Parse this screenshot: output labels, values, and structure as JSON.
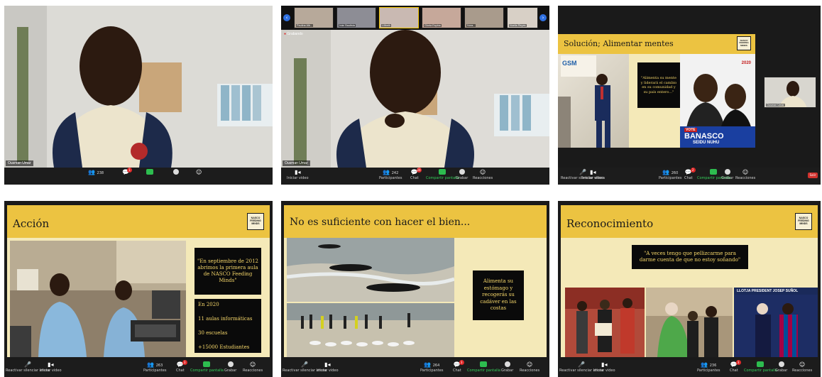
{
  "panels": {
    "p1": {
      "speaker_name": "Ousman Umar",
      "participants_count": "238",
      "chat_badge": "1"
    },
    "p2": {
      "gallery": [
        {
          "name": "Paulina Alb..."
        },
        {
          "name": "Iván Bautista"
        },
        {
          "name": "Lilibeth"
        },
        {
          "name": "Gloria Espina"
        },
        {
          "name": "Nora..."
        },
        {
          "name": "Noelia Reyes"
        }
      ],
      "recording_label": "Grabando",
      "speaker_name": "Ousman Umar",
      "participants_count": "242",
      "chat_badge": "24",
      "controls": {
        "start_video": "Iniciar video",
        "participants": "Participantes",
        "chat": "Chat",
        "share": "Compartir pantalla",
        "record": "Grabar",
        "reactions": "Reacciones"
      }
    },
    "p3": {
      "slide_title": "Solución; Alimentar mentes",
      "logo_text": "NASCO\nFEEDING\nMINDS",
      "quote": "\"Alimenta su mente y liderará el cambio en su comunidad y su país entero...\"",
      "poster_year": "2020",
      "poster_vote": "VOTE",
      "poster_name1": "BANASCO",
      "poster_name2": "SEIDU NUHU",
      "side_thumb_name": "Ousman Umar",
      "participants_count": "260",
      "chat_badge": "2",
      "controls": {
        "unmute": "Reactivar silenciar ahora",
        "start_video": "Iniciar video",
        "participants": "Participantes",
        "chat": "Chat",
        "share": "Compartir pantalla",
        "record": "Grabar",
        "reactions": "Reacciones",
        "leave": "Salir"
      }
    },
    "p4": {
      "slide_title": "Acción",
      "logo_text": "NASCO\nFEEDING\nMINDS",
      "quote": "\"En septiembre de 2012 abrimos la primera aula de NASCO Feeding Minds\"",
      "stats": [
        "En 2020",
        "11 aulas informáticas",
        "30 escuelas",
        "+15000 Estudiantes"
      ],
      "participants_count": "263",
      "chat_badge": "3",
      "controls": {
        "unmute": "Reactivar silenciar ahora",
        "start_video": "Iniciar video",
        "participants": "Participantes",
        "chat": "Chat",
        "share": "Compartir pantalla",
        "record": "Grabar",
        "reactions": "Reacciones"
      }
    },
    "p5": {
      "slide_title": "No es suficiente con hacer el bien...",
      "quote": "Alimenta su estómago y recogerás su cadáver en las costas",
      "participants_count": "264",
      "chat_badge": "3",
      "controls": {
        "unmute": "Reactivar silenciar ahora",
        "start_video": "Iniciar video",
        "participants": "Participantes",
        "chat": "Chat",
        "share": "Compartir pantalla",
        "record": "Grabar",
        "reactions": "Reacciones"
      }
    },
    "p6": {
      "slide_title": "Reconocimiento",
      "logo_text": "NASCO\nFEEDING\nMINDS",
      "quote": "\"A veces tengo que pellizcarme para darme cuenta de que no estoy soñando\"",
      "banner_text": "LLOTJA PRESIDENT JOSEP SUÑOL",
      "participants_count": "236",
      "chat_badge": "3",
      "controls": {
        "unmute": "Reactivar silenciar ahora",
        "start_video": "Iniciar video",
        "participants": "Participantes",
        "chat": "Chat",
        "share": "Compartir pantalla",
        "record": "Grabar",
        "reactions": "Reacciones"
      }
    }
  },
  "colors": {
    "slide_yellow": "#ecc341",
    "slide_cream": "#f4e9b8",
    "zoom_green": "#2dbd4f",
    "zoom_red": "#e02828"
  }
}
